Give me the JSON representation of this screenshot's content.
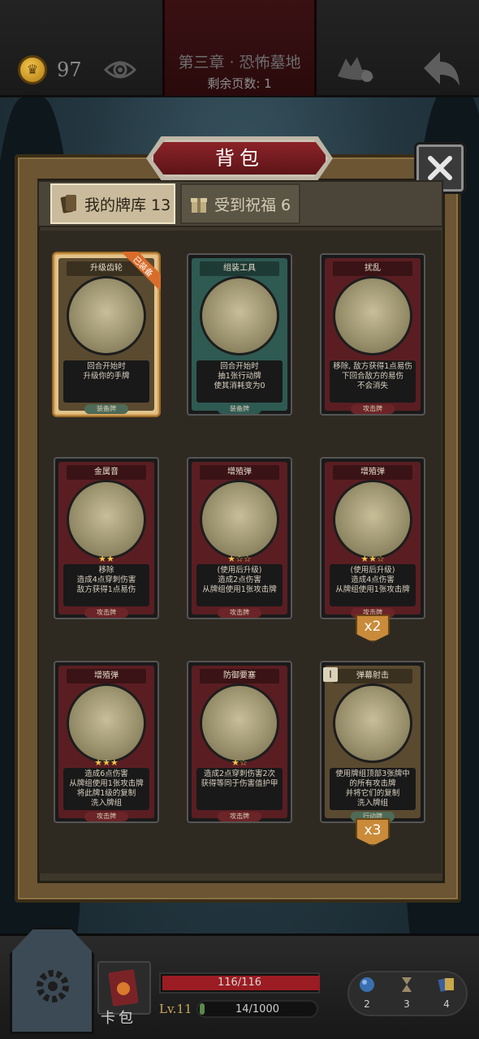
{
  "header": {
    "coin_icon": "crown-coin-icon",
    "coins": "97",
    "chapter": "第三章 · 恐怖墓地",
    "pages_left": "剩余页数: 1"
  },
  "modal": {
    "title": "背包",
    "tabs": [
      {
        "label": "我的牌库 13",
        "icon": "card-deck-icon",
        "active": true
      },
      {
        "label": "受到祝福 6",
        "icon": "gift-icon",
        "active": false
      }
    ]
  },
  "cards": [
    {
      "title": "升级齿轮",
      "desc": [
        "回合开始时",
        "升级你的手牌"
      ],
      "type": "装备牌",
      "color": "tan",
      "equipped_label": "已装备",
      "stars": ""
    },
    {
      "title": "组装工具",
      "desc": [
        "回合开始时",
        "抽1张行动牌",
        "使其消耗变为0"
      ],
      "type": "装备牌",
      "color": "teal",
      "stars": ""
    },
    {
      "title": "扰乱",
      "desc": [
        "移除, 敌方获得1点易伤",
        "下回合敌方的易伤",
        "不会消失"
      ],
      "type": "攻击牌",
      "color": "red",
      "stars": ""
    },
    {
      "title": "金属音",
      "desc": [
        "移除",
        "造成4点穿刺伤害",
        "敌方获得1点易伤"
      ],
      "type": "攻击牌",
      "color": "red",
      "stars": "★★"
    },
    {
      "title": "增殖弹",
      "desc": [
        "(使用后升级)",
        "造成2点伤害",
        "从牌组使用1张攻击牌"
      ],
      "type": "攻击牌",
      "color": "red",
      "stars": "★☆☆"
    },
    {
      "title": "增殖弹",
      "desc": [
        "(使用后升级)",
        "造成4点伤害",
        "从牌组使用1张攻击牌"
      ],
      "type": "攻击牌",
      "color": "red",
      "stars": "★★☆",
      "count": "x2"
    },
    {
      "title": "增殖弹",
      "desc": [
        "造成6点伤害",
        "从牌组使用1张攻击牌",
        "将此牌1级的复制",
        "洗入牌组"
      ],
      "type": "攻击牌",
      "color": "red",
      "stars": "★★★"
    },
    {
      "title": "防御要塞",
      "desc": [
        "造成2点穿刺伤害2次",
        "获得等同于伤害值护甲"
      ],
      "type": "攻击牌",
      "color": "red",
      "stars": "★☆"
    },
    {
      "title": "弹幕射击",
      "desc": [
        "使用牌组顶部3张牌中",
        "的所有攻击牌",
        "并将它们的复制",
        "洗入牌组"
      ],
      "type": "行动牌",
      "color": "tan",
      "stars": "",
      "count": "x3",
      "rank": "I"
    }
  ],
  "footer": {
    "deck_label": "卡包",
    "hp": "116/116",
    "hp_ratio": 1.0,
    "level": "Lv.11",
    "xp": "14/1000",
    "xp_ratio": 0.014,
    "resources": [
      {
        "icon": "blue-orb-icon",
        "value": "2"
      },
      {
        "icon": "hourglass-icon",
        "value": "3"
      },
      {
        "icon": "cards-icon",
        "value": "4"
      }
    ]
  }
}
